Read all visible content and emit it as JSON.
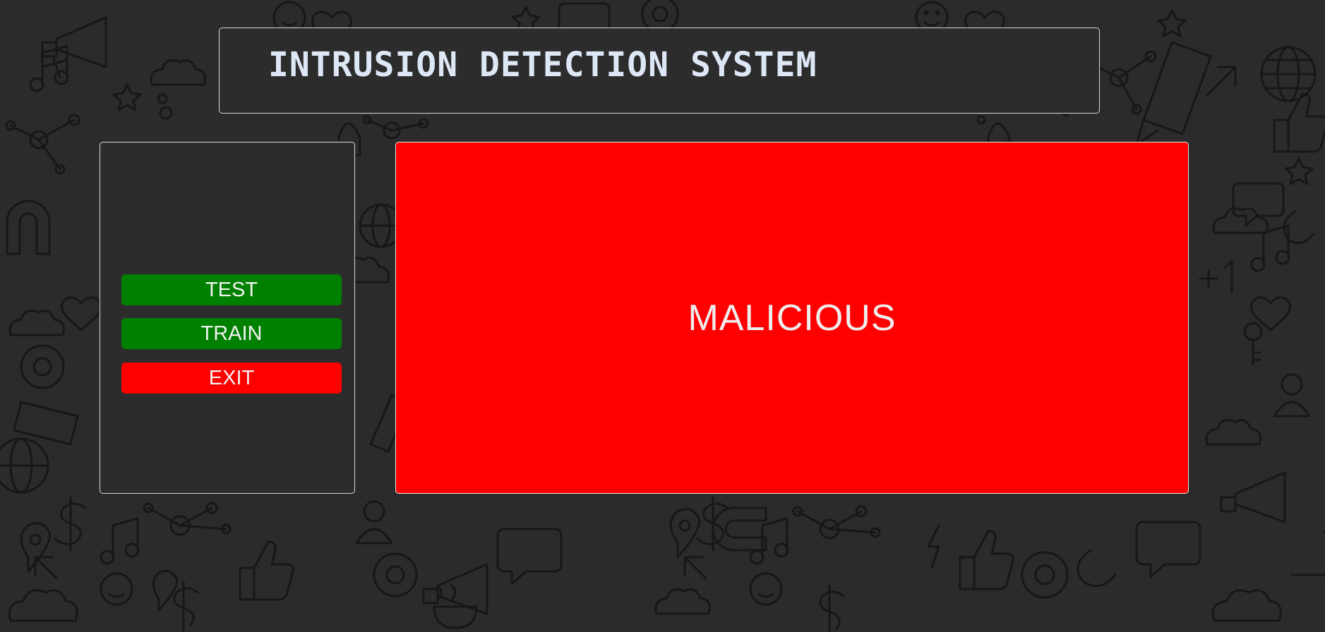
{
  "window": {
    "title": "INTRUSION DETECTION SYSTEM"
  },
  "sidebar": {
    "buttons": [
      {
        "label": "TEST",
        "color": "#008000"
      },
      {
        "label": "TRAIN",
        "color": "#008000"
      },
      {
        "label": "EXIT",
        "color": "#ff0000"
      }
    ]
  },
  "result": {
    "label": "MALICIOUS",
    "background_color": "#ff0000"
  },
  "theme": {
    "background": "#2b2b2b",
    "panel": "#2c2c2c",
    "title_color": "#dde7f5",
    "background_pattern": "doodle-icons"
  }
}
